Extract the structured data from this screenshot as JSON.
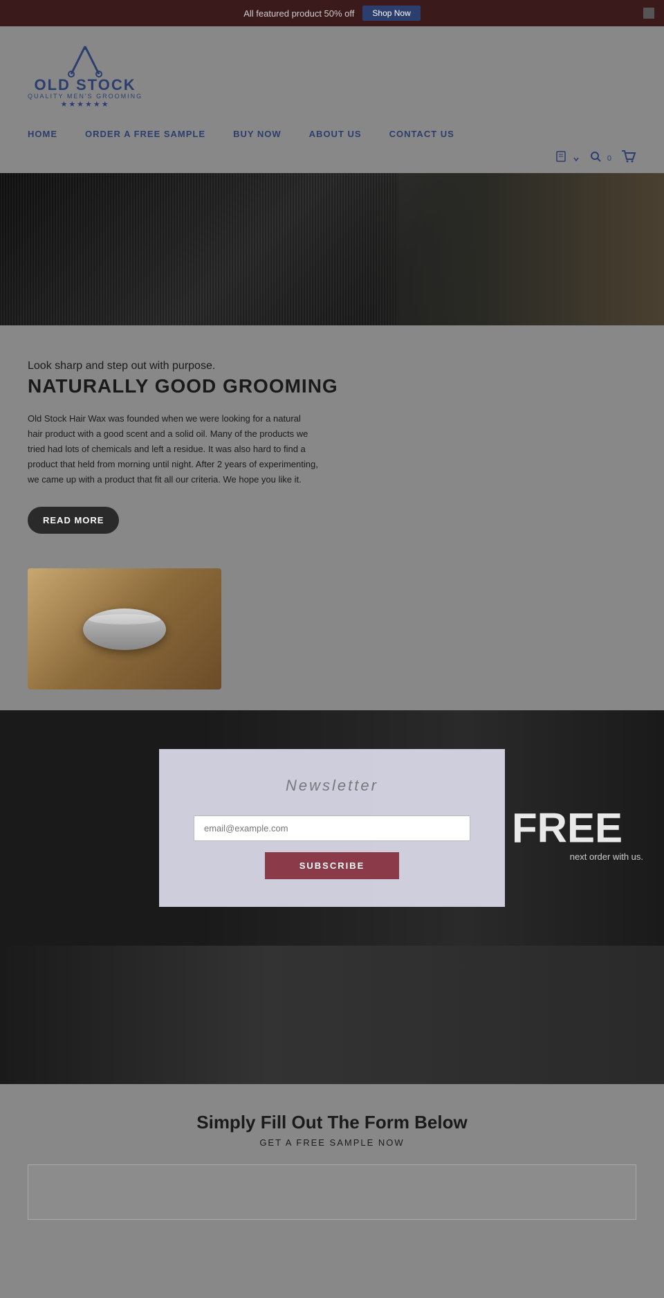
{
  "announcement": {
    "text": "All featured product 50% off",
    "shop_now_label": "Shop Now"
  },
  "header": {
    "logo": {
      "brand_name": "OLD STOCK",
      "tagline": "QUALITY MEN'S GROOMING",
      "stars": "★★★★★★"
    }
  },
  "nav": {
    "items": [
      {
        "label": "HOME",
        "id": "home"
      },
      {
        "label": "ORDER A FREE SAMPLE",
        "id": "order-free-sample"
      },
      {
        "label": "BUY NOW",
        "id": "buy-now"
      },
      {
        "label": "ABOUT US",
        "id": "about-us"
      },
      {
        "label": "CONTACT US",
        "id": "contact-us"
      }
    ]
  },
  "cart": {
    "count": "0"
  },
  "about": {
    "subtitle": "Look sharp and step out with purpose.",
    "title": "NATURALLY GOOD GROOMING",
    "body": "Old Stock Hair Wax was founded when we were looking for a natural hair product with a good scent and a solid oil. Many of the products we tried had lots of chemicals and left a residue. It was also hard to find a product that held from morning until night. After 2 years of experimenting, we came up with a product that fit all our criteria. We hope you like it.",
    "read_more_label": "READ MORE"
  },
  "newsletter": {
    "modal_title": "Newsletter",
    "email_placeholder": "email@example.com",
    "subscribe_label": "SUBSCRIBE",
    "free_label": "FREE",
    "free_subtext": "next order with us."
  },
  "free_sample_form": {
    "title": "Simply Fill Out The Form Below",
    "subtitle": "GET A FREE SAMPLE NOW"
  }
}
